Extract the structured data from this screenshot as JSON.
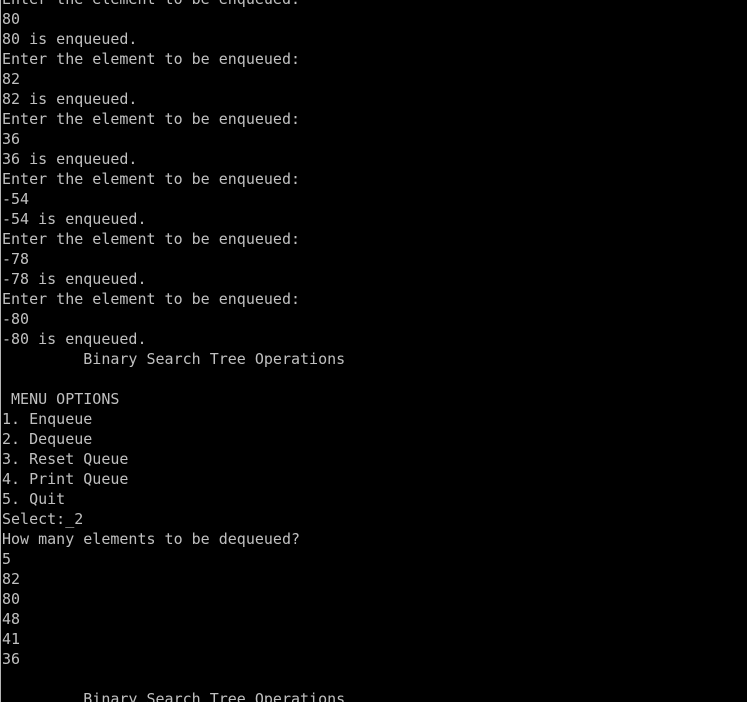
{
  "console": {
    "lines": [
      "Enter the element to be enqueued:",
      "80",
      "80 is enqueued.",
      "Enter the element to be enqueued:",
      "82",
      "82 is enqueued.",
      "Enter the element to be enqueued:",
      "36",
      "36 is enqueued.",
      "Enter the element to be enqueued:",
      "-54",
      "-54 is enqueued.",
      "Enter the element to be enqueued:",
      "-78",
      "-78 is enqueued.",
      "Enter the element to be enqueued:",
      "-80",
      "-80 is enqueued.",
      "         Binary Search Tree Operations",
      "",
      " MENU OPTIONS",
      "1. Enqueue",
      "2. Dequeue",
      "3. Reset Queue",
      "4. Print Queue",
      "5. Quit",
      "Select:_2",
      "How many elements to be dequeued?",
      "5",
      "82",
      "80",
      "48",
      "41",
      "36",
      "",
      "         Binary Search Tree Operations"
    ]
  },
  "colors": {
    "background": "#000000",
    "text": "#c0c0c0",
    "border": "#b5b5b5"
  }
}
